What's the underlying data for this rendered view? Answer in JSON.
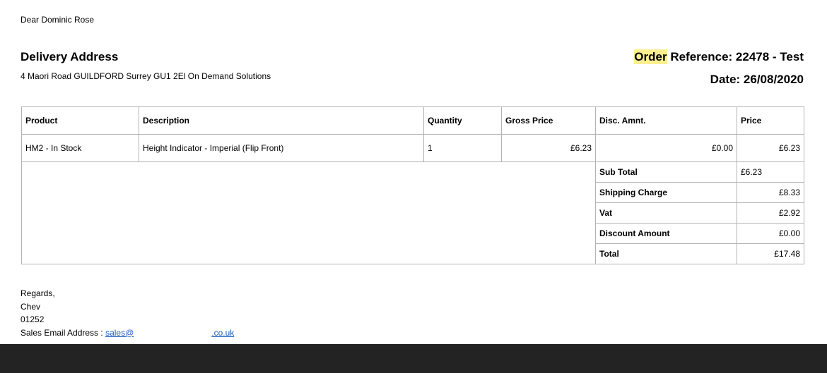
{
  "greeting": "Dear Dominic Rose",
  "delivery": {
    "title": "Delivery Address",
    "address": "4 Maori Road GUILDFORD Surrey GU1 2El On Demand Solutions"
  },
  "order": {
    "highlight_word": "Order",
    "reference_rest": " Reference: 22478 - Test",
    "date_line": "Date: 26/08/2020"
  },
  "table": {
    "headers": [
      "Product",
      "Description",
      "Quantity",
      "Gross Price",
      "Disc. Amnt.",
      "Price"
    ],
    "items": [
      {
        "product": "HM2 - In Stock",
        "description": "Height Indicator - Imperial (Flip Front)",
        "quantity": "1",
        "gross": "£6.23",
        "disc": "£0.00",
        "price": "£6.23"
      }
    ],
    "summary": [
      {
        "label": "Sub Total",
        "value": "£6.23"
      },
      {
        "label": "Shipping Charge",
        "value": "£8.33"
      },
      {
        "label": "Vat",
        "value": "£2.92"
      },
      {
        "label": "Discount Amount",
        "value": "£0.00"
      },
      {
        "label": "Total",
        "value": "£17.48"
      }
    ]
  },
  "footer": {
    "regards": "Regards,",
    "name": "Chev",
    "phone": "01252",
    "email_label": "Sales Email Address : ",
    "email_part1": "sales@",
    "email_part2": ".co.uk"
  },
  "colors": {
    "highlight": "#fcef8f",
    "link": "#1f5fbf",
    "bottom_bar": "#232323"
  }
}
